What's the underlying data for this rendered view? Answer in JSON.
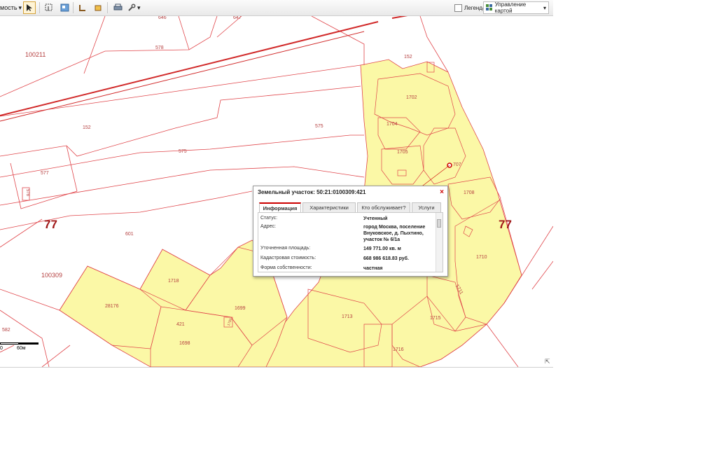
{
  "toolbar": {
    "mode_label": "мость",
    "legend_label": "Легенда",
    "map_control_label": "Управление картой"
  },
  "map": {
    "parcels": {
      "p646": "646",
      "p647": "647",
      "p578": "578",
      "p152a": "152",
      "p152b": "152",
      "p575a": "575",
      "p575b": "575",
      "p577": "577",
      "p578s": "578",
      "p1702": "1702",
      "p1704": "1704",
      "p1705": "1705",
      "p1707": "707",
      "p1708": "1708",
      "p1710": "1710",
      "p1711": "1711",
      "p1713": "1713",
      "p1715": "1715",
      "p1716": "1716",
      "p1718": "1718",
      "p1699": "1699",
      "p28176": "28176",
      "p421": "421",
      "p1698": "1698",
      "p1700": "1700",
      "p601": "601",
      "p582": "582"
    },
    "blocks": {
      "b100211": "100211",
      "b100309": "100309"
    },
    "region_left": "77",
    "region_right": "77",
    "scale_zero": "0",
    "scale_label": "60м"
  },
  "popup": {
    "title": "Земельный участок: 50:21:0100309:421",
    "close": "×",
    "tabs": [
      "Информация",
      "Характеристики",
      "Кто обслуживает?",
      "Услуги"
    ],
    "rows": [
      {
        "label": "Статус:",
        "value": "Учтенный"
      },
      {
        "label": "Адрес:",
        "value": "город Москва, поселение Внуковское, д. Пыхтино, участок № 6/1а"
      },
      {
        "label": "Уточненная площадь:",
        "value": "149 771.00 кв. м"
      },
      {
        "label": "Кадастровая стоимость:",
        "value": "668 986 618.83 руб."
      },
      {
        "label": "Форма собственности:",
        "value": "частная"
      }
    ]
  },
  "colors": {
    "parcel_fill": "#fbf8a6",
    "parcel_line": "#e0454a",
    "road_line": "#d12a2a"
  }
}
